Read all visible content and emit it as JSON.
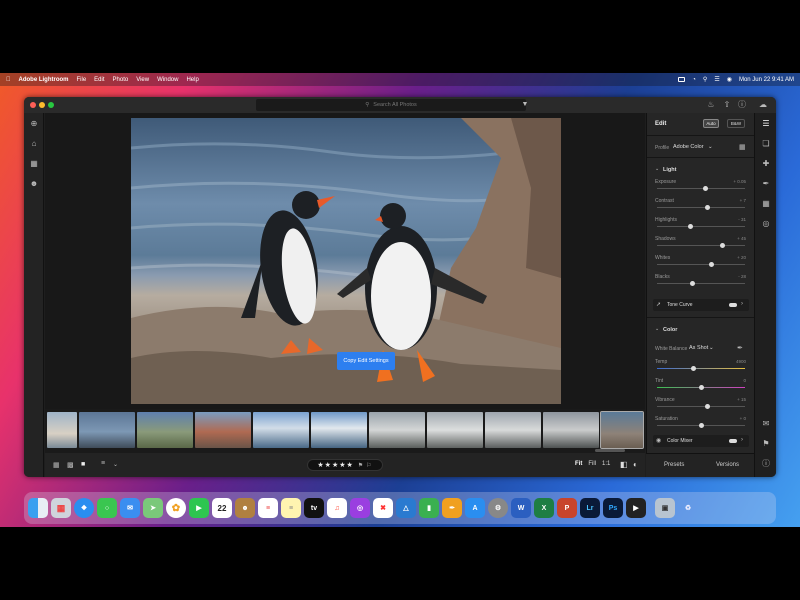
{
  "menubar": {
    "app_name": "Adobe Lightroom",
    "menus": [
      "File",
      "Edit",
      "Photo",
      "View",
      "Window",
      "Help"
    ],
    "clock": "Mon Jun 22  9:41 AM"
  },
  "window": {
    "search_placeholder": "Search All Photos"
  },
  "canvas": {
    "copy_button": "Copy Edit Settings"
  },
  "bottombar": {
    "stars": "★★★★★",
    "zoom": [
      "Fit",
      "Fill",
      "1:1"
    ]
  },
  "edit_panel": {
    "title": "Edit",
    "auto_label": "Auto",
    "bw_label": "B&W",
    "profile_label": "Profile",
    "profile_value": "Adobe Color",
    "light_title": "Light",
    "light_sliders": [
      {
        "label": "Exposure",
        "value": "+ 0.05",
        "pos": 0.55
      },
      {
        "label": "Contrast",
        "value": "+ 7",
        "pos": 0.57
      },
      {
        "label": "Highlights",
        "value": "- 31",
        "pos": 0.38
      },
      {
        "label": "Shadows",
        "value": "+ 45",
        "pos": 0.74
      },
      {
        "label": "Whites",
        "value": "+ 20",
        "pos": 0.62
      },
      {
        "label": "Blacks",
        "value": "- 28",
        "pos": 0.4
      }
    ],
    "tone_curve": "Tone Curve",
    "color_title": "Color",
    "white_balance_label": "White Balance",
    "white_balance_value": "As Shot",
    "color_sliders": [
      {
        "label": "Temp",
        "value": "4900",
        "pos": 0.42
      },
      {
        "label": "Tint",
        "value": "0",
        "pos": 0.5
      },
      {
        "label": "Vibrance",
        "value": "+ 15",
        "pos": 0.57
      },
      {
        "label": "Saturation",
        "value": "+ 0",
        "pos": 0.5
      }
    ],
    "color_mixer": "Color Mixer",
    "presets_label": "Presets",
    "versions_label": "Versions"
  },
  "colors": {
    "accent": "#2d7ff0",
    "panel": "#262626",
    "window": "#1e1e1e"
  },
  "dock": {
    "icons": [
      "finder-icon",
      "launchpad-icon",
      "safari-icon",
      "messages-icon",
      "mail-icon",
      "maps-icon",
      "photos-icon",
      "facetime-icon",
      "calendar-icon",
      "contacts-icon",
      "reminders-icon",
      "notes-icon",
      "appletv-icon",
      "music-icon",
      "podcasts-icon",
      "news-icon",
      "keynote-icon",
      "numbers-icon",
      "pages-icon",
      "appstore-icon",
      "settings-icon",
      "word-icon",
      "excel-icon",
      "powerpoint-icon",
      "lightroom-icon",
      "photoshop-icon",
      "finalcut-icon",
      "preview-icon",
      "trash-icon"
    ],
    "calendar_day": "22",
    "word_letter": "W",
    "excel_letter": "X",
    "powerpoint_letter": "P",
    "lightroom_letters": "Lr",
    "photoshop_letters": "Ps",
    "appletv_label": "tv"
  }
}
